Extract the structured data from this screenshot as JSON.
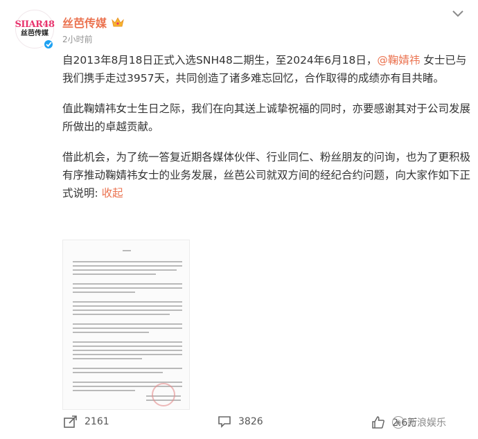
{
  "author": {
    "name": "丝芭传媒",
    "time": "2小时前",
    "avatar_text_top": "SIIAR48",
    "avatar_text_bottom": "丝芭传媒"
  },
  "post": {
    "p1_before": "自2013年8月18日正式入选SNH48二期生，至2024年6月18日，",
    "mention": "@鞠婧祎",
    "p1_after": " 女士已与我们携手走过3957天，共同创造了诸多难忘回忆，合作取得的成绩亦有目共睹。",
    "p2": "值此鞠婧祎女士生日之际，我们在向其送上诚挚祝福的同时，亦要感谢其对于公司发展所做出的卓越贡献。",
    "p3": "借此机会，为了统一答复近期各媒体伙伴、行业同仁、粉丝朋友的问询，也为了更积极有序推动鞠婧祎女士的业务发展，丝芭公司就双方间的经纪合约问题，向大家作如下正式说明: ",
    "collapse_label": "收起"
  },
  "footer": {
    "share_count": "2161",
    "comment_count": "3826",
    "like_count": "2.6万",
    "watermark": "新浪娱乐"
  },
  "colors": {
    "accent": "#eb7350",
    "verified": "#1da1f2"
  },
  "icons": [
    "crown-icon",
    "chevron-down-icon",
    "share-icon",
    "comment-icon",
    "like-icon",
    "verified-icon",
    "weibo-icon"
  ]
}
